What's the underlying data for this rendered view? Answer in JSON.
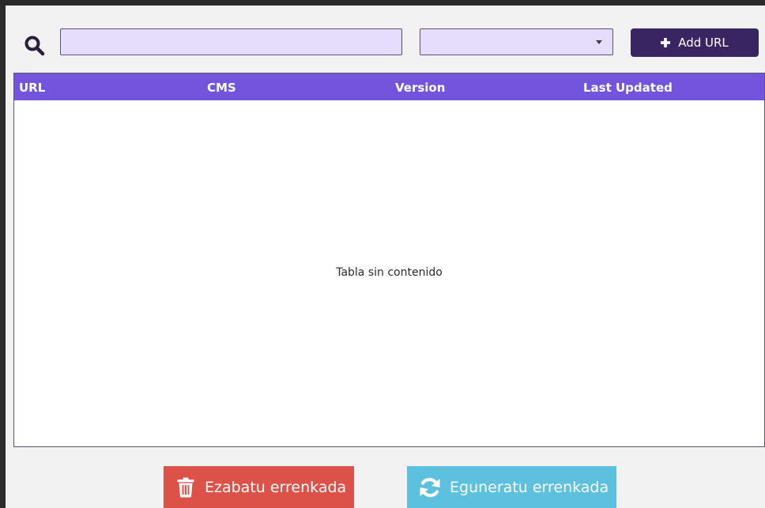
{
  "search": {
    "icon": "magnifier-icon",
    "value": "",
    "placeholder": ""
  },
  "filter": {
    "selected": "",
    "icon": "chevron-down-icon"
  },
  "toolbar": {
    "add_url_label": "Add URL",
    "add_url_icon": "plus-icon"
  },
  "table": {
    "columns": [
      "URL",
      "CMS",
      "Version",
      "Last Updated"
    ],
    "rows": [],
    "empty_message": "Tabla sin contenido"
  },
  "actions": {
    "delete_label": "Ezabatu errenkada",
    "delete_icon": "trash-icon",
    "refresh_label": "Eguneratu errenkada",
    "refresh_icon": "refresh-icon"
  },
  "colors": {
    "header_bg": "#7354dd",
    "input_bg": "#e6dcfb",
    "add_button_bg": "#3a2563",
    "delete_button_bg": "#dc5148",
    "refresh_button_bg": "#5dc0de",
    "window_bg": "#f2f2f2"
  }
}
